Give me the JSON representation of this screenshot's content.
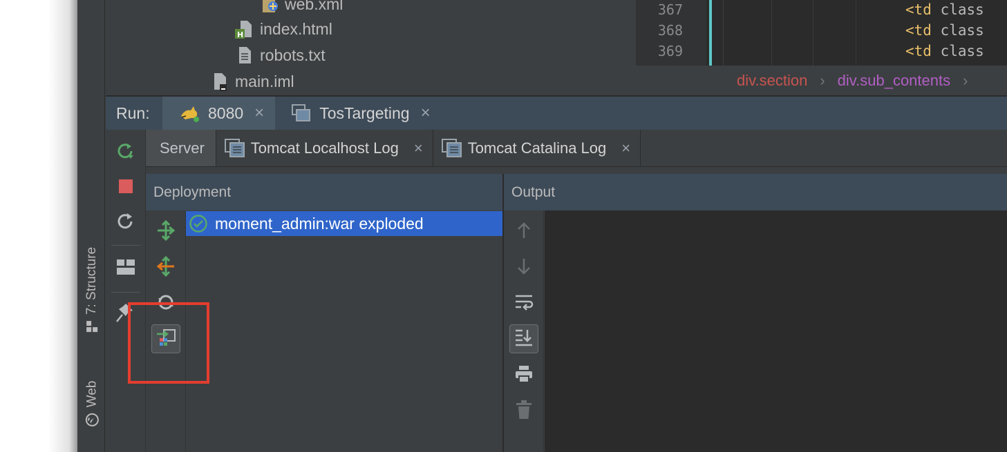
{
  "left_strip": {
    "structure_tab": "7: Structure",
    "web_tab": "Web"
  },
  "project_tree": [
    {
      "label": "web.xml",
      "icon": "xml-file-icon"
    },
    {
      "label": "index.html",
      "icon": "html-file-icon"
    },
    {
      "label": "robots.txt",
      "icon": "text-file-icon"
    },
    {
      "label": "main.iml",
      "icon": "iml-file-icon"
    }
  ],
  "editor": {
    "line_numbers": [
      "367",
      "368",
      "369"
    ],
    "code_lines": [
      {
        "tag": "<td",
        "attr": " class"
      },
      {
        "tag": "<td",
        "attr": " class"
      },
      {
        "tag": "<td",
        "attr": " class"
      }
    ],
    "breadcrumbs": [
      "div.section",
      "div.sub_contents"
    ],
    "breadcrumb_colors": [
      "#c75450",
      "#b05fc4"
    ],
    "breadcrumb_separator": "›"
  },
  "run": {
    "label": "Run:",
    "tabs": [
      {
        "label": "8080",
        "icon": "tomcat-icon",
        "close": "×"
      },
      {
        "label": "TosTargeting",
        "icon": "window-icon",
        "close": "×"
      }
    ]
  },
  "server_tabs": [
    {
      "label": "Server"
    },
    {
      "label": "Tomcat Localhost Log",
      "icon": "log-icon",
      "close": "×"
    },
    {
      "label": "Tomcat Catalina Log",
      "icon": "log-icon",
      "close": "×"
    }
  ],
  "deployment": {
    "header": "Deployment",
    "items": [
      {
        "label": "moment_admin:war exploded",
        "status_icon": "check-circle-icon"
      }
    ]
  },
  "output": {
    "header": "Output"
  },
  "colors": {
    "accent_selection": "#2f65ca",
    "highlight_box": "#e43d2f",
    "run_green": "#59a869",
    "stop_red": "#db5c5c"
  }
}
